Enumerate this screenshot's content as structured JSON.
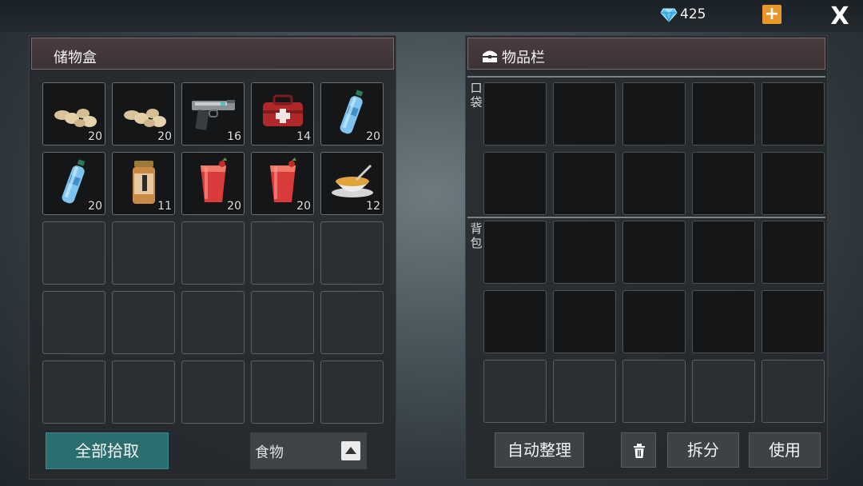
{
  "currency": {
    "icon": "diamond-icon",
    "amount": "425",
    "add_icon": "plus-icon",
    "add_label": "+"
  },
  "close": {
    "icon": "close-icon",
    "label": "X"
  },
  "storage": {
    "title": "储物盒",
    "items": [
      {
        "icon": "potato-icon",
        "qty": "20"
      },
      {
        "icon": "potato-icon",
        "qty": "20"
      },
      {
        "icon": "pistol-icon",
        "qty": "16"
      },
      {
        "icon": "first-aid-kit-icon",
        "qty": "14"
      },
      {
        "icon": "water-bottle-icon",
        "qty": "20"
      },
      {
        "icon": "water-bottle-icon",
        "qty": "20"
      },
      {
        "icon": "canned-jar-icon",
        "qty": "11"
      },
      {
        "icon": "tomato-juice-icon",
        "qty": "20"
      },
      {
        "icon": "tomato-juice-icon",
        "qty": "20"
      },
      {
        "icon": "soup-bowl-icon",
        "qty": "12"
      }
    ],
    "collect_all_label": "全部拾取",
    "filter_value": "食物"
  },
  "inventory": {
    "title": "物品栏",
    "pocket_label": "口袋",
    "backpack_label": "背包",
    "sort_label": "自动整理",
    "split_label": "拆分",
    "use_label": "使用",
    "delete_icon": "trash-icon"
  }
}
